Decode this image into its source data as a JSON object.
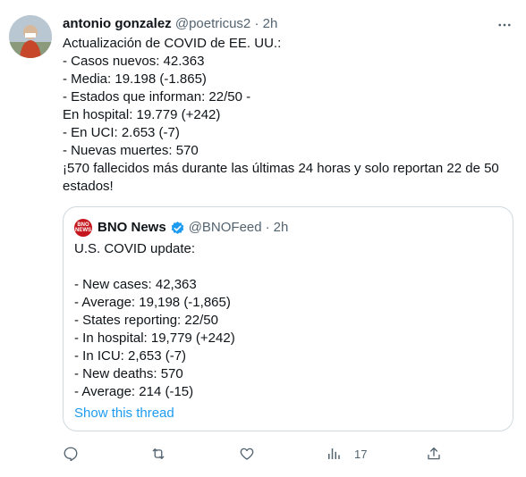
{
  "tweet": {
    "author_name": "antonio gonzalez",
    "handle": "@poetricus2",
    "separator": "·",
    "time": "2h",
    "lines": [
      "Actualización de COVID de EE. UU.:",
      "- Casos nuevos: 42.363",
      "- Media: 19.198 (-1.865)",
      "- Estados que informan: 22/50 -",
      "En hospital: 19.779 (+242)",
      "- En UCI: 2.653 (-7)",
      "- Nuevas muertes: 570",
      "¡570 fallecidos más durante las últimas 24 horas y solo reportan 22 de 50 estados!"
    ]
  },
  "quote": {
    "logo_text_top": "BNO",
    "logo_text_bottom": "NEWS",
    "author_name": "BNO News",
    "handle": "@BNOFeed",
    "separator": "·",
    "time": "2h",
    "lines": [
      "U.S. COVID update:",
      "",
      "- New cases: 42,363",
      "- Average: 19,198 (-1,865)",
      "- States reporting: 22/50",
      "- In hospital: 19,779 (+242)",
      "- In ICU: 2,653 (-7)",
      "- New deaths: 570",
      "- Average: 214 (-15)"
    ],
    "show_thread": "Show this thread"
  },
  "actions": {
    "reply_icon": "reply-icon",
    "retweet_icon": "retweet-icon",
    "like_icon": "like-icon",
    "analytics_icon": "analytics-icon",
    "analytics_count": "17",
    "share_icon": "share-icon"
  },
  "colors": {
    "text": "#0f1419",
    "secondary": "#536471",
    "link": "#1d9bf0",
    "border": "#cfd9de",
    "verified": "#1d9bf0",
    "bno_red": "#c4161c"
  }
}
